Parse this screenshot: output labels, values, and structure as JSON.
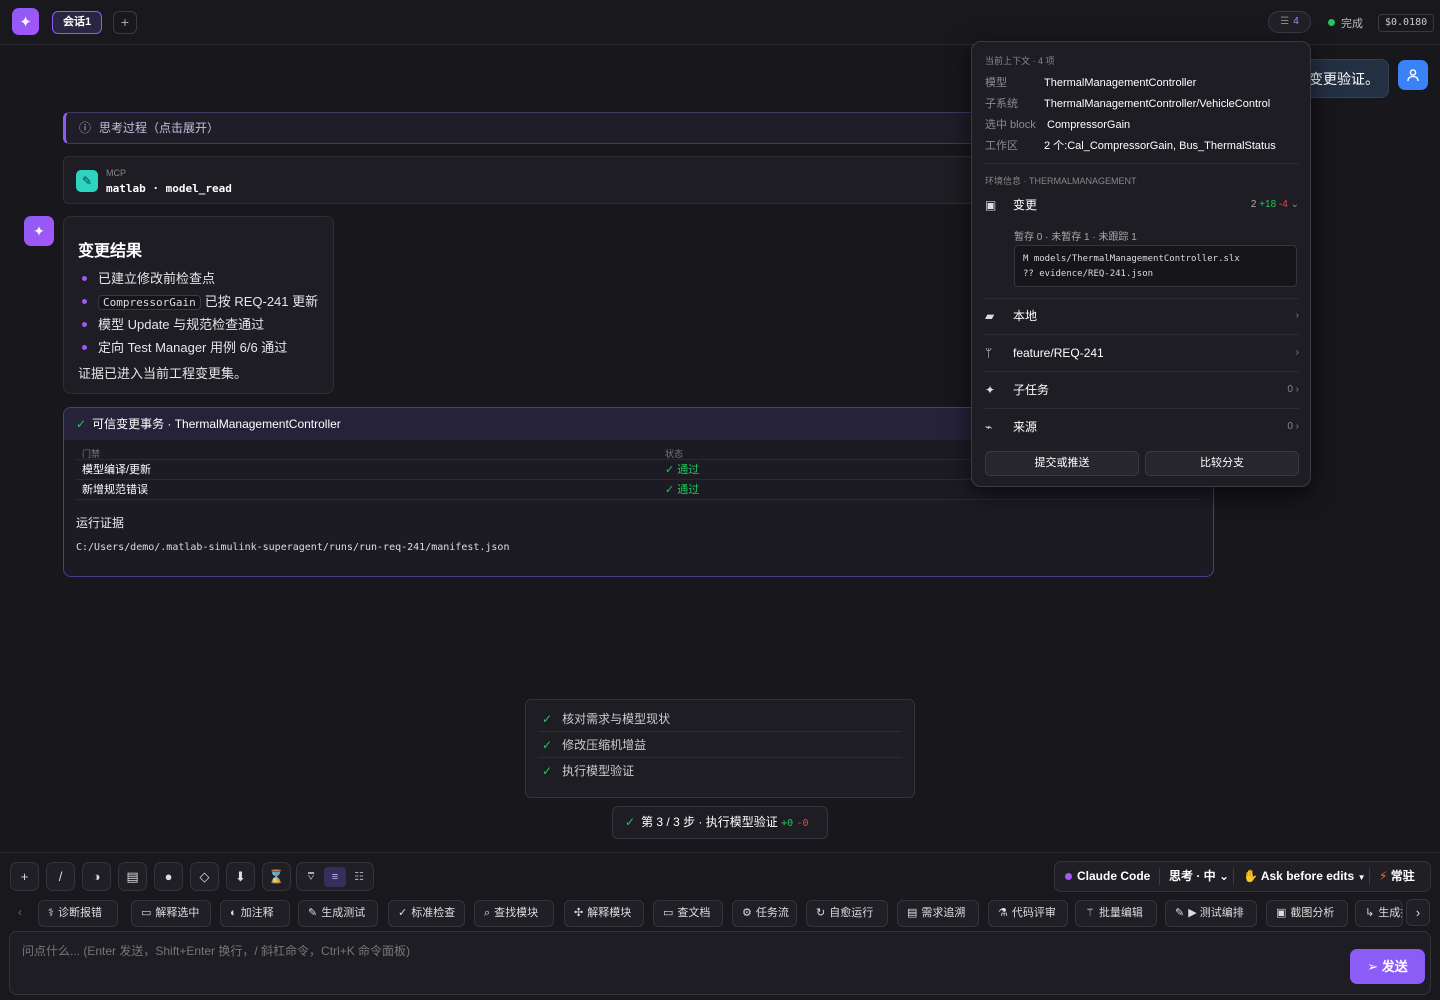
{
  "topbar": {
    "tab_label": "会话1",
    "add_tab": "+",
    "context_count": "4",
    "status": "完成",
    "cost": "$0.0180"
  },
  "conversation": {
    "user_message_visible": "变更验证。",
    "thinking_label": "思考过程（点击展开）",
    "mcp": {
      "label": "MCP",
      "name": "matlab · model_read"
    },
    "result": {
      "title": "变更结果",
      "items": [
        "已建立修改前检查点",
        "已按 REQ-241 更新",
        "模型 Update 与规范检查通过",
        "定向 Test Manager 用例 6/6 通过"
      ],
      "code_chip": "CompressorGain",
      "tail": "证据已进入当前工程变更集。"
    },
    "trust": {
      "title": "可信变更事务 · ThermalManagementController",
      "col_gate": "门禁",
      "col_status": "状态",
      "rows": [
        {
          "gate": "模型编译/更新",
          "status": "✓ 通过"
        },
        {
          "gate": "新增规范错误",
          "status": "✓ 通过"
        }
      ],
      "evidence_title": "运行证据",
      "evidence_path": "C:/Users/demo/.matlab-simulink-superagent/runs/run-req-241/manifest.json"
    }
  },
  "context_popover": {
    "caption": "当前上下文 · 4 项",
    "model_key": "模型",
    "model_val": "ThermalManagementController",
    "subsystem_key": "子系统",
    "subsystem_val": "ThermalManagementController/VehicleControl",
    "block_key": "选中 block",
    "block_val": "CompressorGain",
    "workspace_key": "工作区",
    "workspace_val": "2 个:Cal_CompressorGain, Bus_ThermalStatus",
    "env_caption": "环境信息 · THERMALMANAGEMENT",
    "changes_label": "变更",
    "changes_count": "2",
    "changes_add": "+18",
    "changes_del": "-4",
    "changes_sub": "暂存 0 · 未暂存 1 · 未跟踪 1",
    "file1": "M  models/ThermalManagementController.slx",
    "file2": "?? evidence/REQ-241.json",
    "local_label": "本地",
    "branch_label": "feature/REQ-241",
    "subtasks_label": "子任务",
    "subtasks_count": "0",
    "sources_label": "来源",
    "sources_count": "0",
    "commit_btn": "提交或推送",
    "compare_btn": "比较分支"
  },
  "todo": {
    "items": [
      "核对需求与模型现状",
      "修改压缩机增益",
      "执行模型验证"
    ],
    "step_label": "第 3 / 3 步 · 执行模型验证",
    "step_add": "+0",
    "step_del": "-0"
  },
  "composer": {
    "mode_agent": "Claude Code",
    "mode_think": "思考 · 中",
    "mode_perm": "Ask before edits",
    "mode_resident": "常驻",
    "quick_actions": [
      "诊断报错",
      "解释选中",
      "加注释",
      "生成测试",
      "标准检查",
      "查找模块",
      "解释模块",
      "查文档",
      "任务流",
      "自愈运行",
      "需求追溯",
      "代码评审",
      "批量编辑",
      "▶ 测试编排",
      "截图分析",
      "生成报告"
    ],
    "placeholder": "问点什么... (Enter 发送，Shift+Enter 换行，/ 斜杠命令，Ctrl+K 命令面板)",
    "send_label": "发送"
  }
}
